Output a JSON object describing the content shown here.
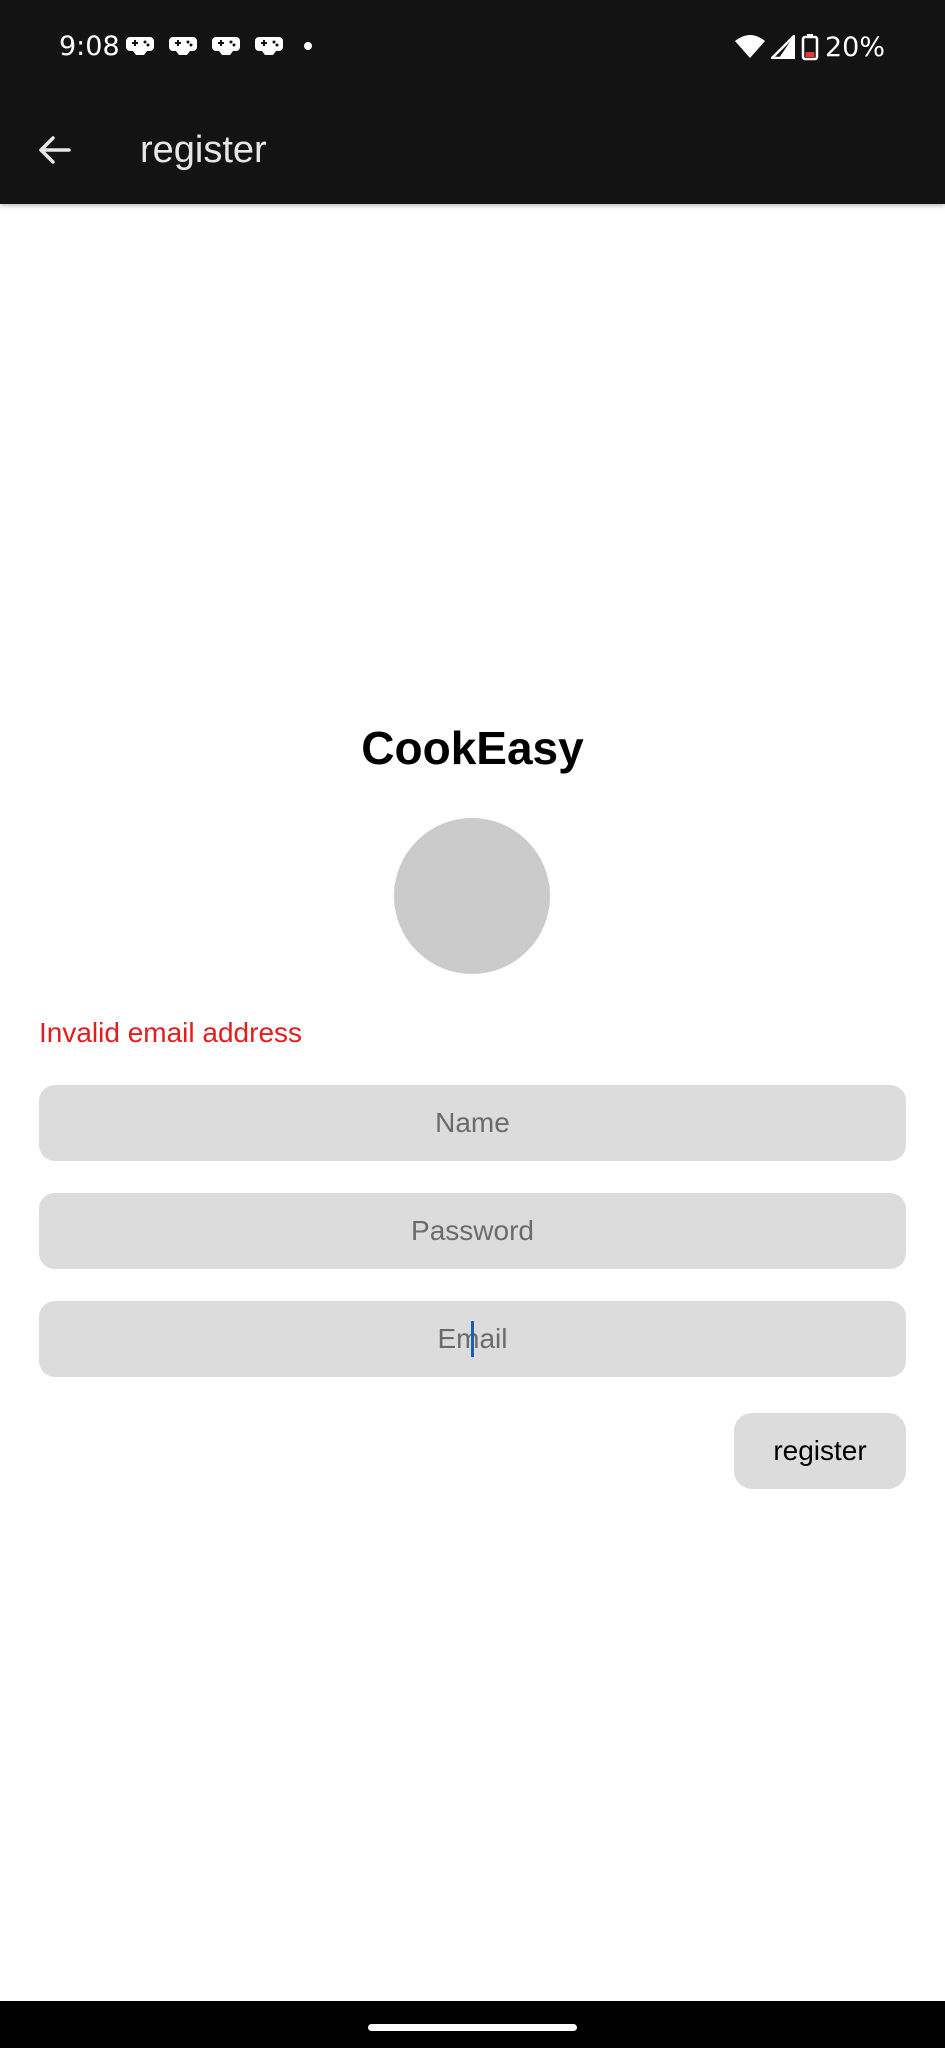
{
  "status_bar": {
    "time": "9:08",
    "battery": "20%",
    "notification_icons": [
      "game-controller-icon",
      "game-controller-icon",
      "game-controller-icon",
      "game-controller-icon"
    ],
    "battery_color": "#e53935"
  },
  "app_bar": {
    "title": "register"
  },
  "main": {
    "brand": "CookEasy",
    "error": "Invalid email address",
    "fields": {
      "name_placeholder": "Name",
      "password_placeholder": "Password",
      "email_placeholder": "Email"
    },
    "register_label": "register"
  },
  "colors": {
    "app_bar": "#131313",
    "field_bg": "#dcdcdc",
    "avatar": "#cbcbcb",
    "error": "#e31c1c",
    "cursor": "#1a5fb4"
  }
}
